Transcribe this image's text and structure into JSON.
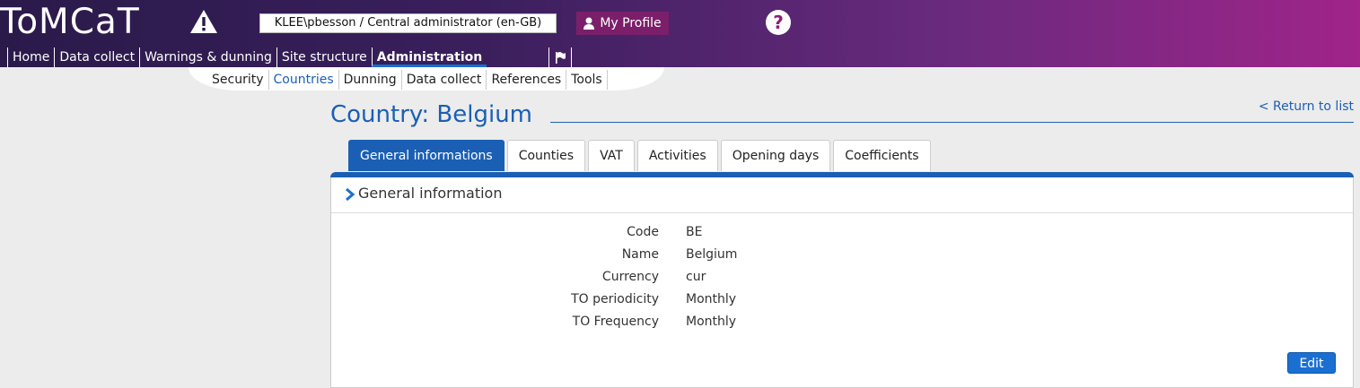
{
  "app": {
    "logo": "ToMCaT"
  },
  "header": {
    "user": "KLEE\\pbesson / Central administrator (en-GB)",
    "profile_label": "My Profile",
    "help_symbol": "?"
  },
  "mainnav": {
    "items": [
      {
        "label": "Home"
      },
      {
        "label": "Data collect"
      },
      {
        "label": "Warnings & dunning"
      },
      {
        "label": "Site structure"
      },
      {
        "label": "Administration"
      }
    ],
    "active": "Administration",
    "flag_icon": "flag-icon"
  },
  "subnav": {
    "items": [
      {
        "label": "Security"
      },
      {
        "label": "Countries"
      },
      {
        "label": "Dunning"
      },
      {
        "label": "Data collect"
      },
      {
        "label": "References"
      },
      {
        "label": "Tools"
      }
    ],
    "active": "Countries"
  },
  "page": {
    "title": "Country: Belgium",
    "return_link": "< Return to list"
  },
  "tabs": [
    {
      "label": "General informations"
    },
    {
      "label": "Counties"
    },
    {
      "label": "VAT"
    },
    {
      "label": "Activities"
    },
    {
      "label": "Opening days"
    },
    {
      "label": "Coefficients"
    }
  ],
  "active_tab": "General informations",
  "section": {
    "title": "General information",
    "fields": [
      {
        "label": "Code",
        "value": "BE"
      },
      {
        "label": "Name",
        "value": "Belgium"
      },
      {
        "label": "Currency",
        "value": "cur"
      },
      {
        "label": "TO periodicity",
        "value": "Monthly"
      },
      {
        "label": "TO Frequency",
        "value": "Monthly"
      }
    ],
    "edit_label": "Edit"
  },
  "colors": {
    "accent": "#1a5fb4",
    "header_start": "#2a1a4a",
    "header_end": "#a0248a",
    "profile": "#7b1f6a"
  }
}
